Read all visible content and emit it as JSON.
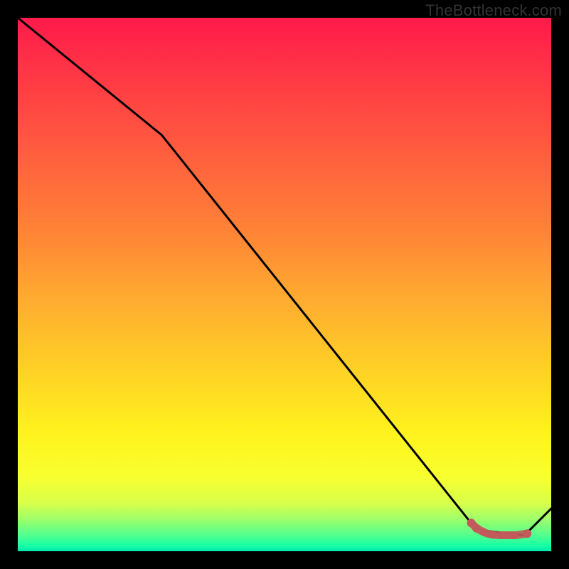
{
  "attribution": "TheBottleneck.com",
  "colors": {
    "background": "#000000",
    "line": "#000000",
    "marker": "#c2595a",
    "gradient_top": "#ff1a4c",
    "gradient_bottom": "#00e6b0"
  },
  "chart_data": {
    "type": "line",
    "title": "",
    "xlabel": "",
    "ylabel": "",
    "xlim": [
      0,
      100
    ],
    "ylim": [
      0,
      100
    ],
    "grid": false,
    "series": [
      {
        "name": "curve",
        "x": [
          0,
          27,
          86,
          95,
          100
        ],
        "y": [
          100,
          78,
          4,
          3,
          8
        ]
      }
    ],
    "markers": {
      "name": "valley-band",
      "x": [
        85,
        86,
        87.3,
        88,
        89,
        90.3,
        91,
        91.7,
        92.7,
        93.3,
        95.5
      ],
      "y": [
        5.3,
        4.3,
        3.6,
        3.3,
        3.1,
        3.0,
        3.0,
        3.0,
        3.0,
        3.0,
        3.3
      ],
      "r": [
        6,
        6,
        5.5,
        4,
        5.5,
        4,
        5.5,
        4,
        5.5,
        4,
        6
      ]
    }
  }
}
